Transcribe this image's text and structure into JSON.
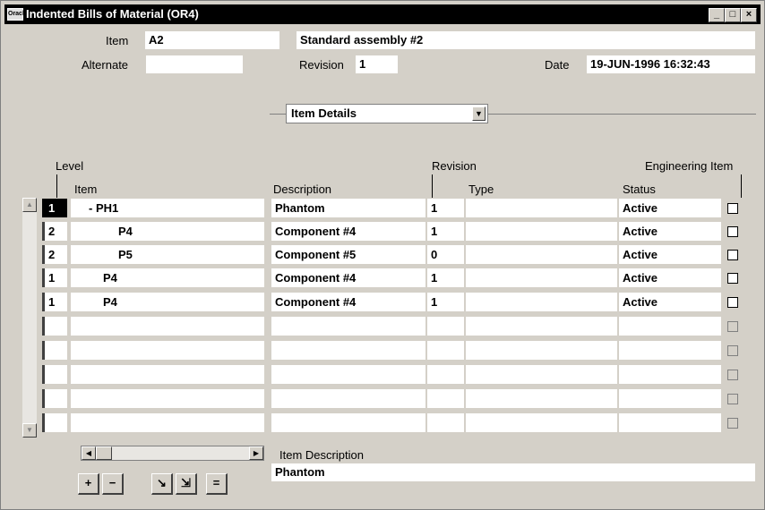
{
  "window": {
    "title": "Indented Bills of Material (OR4)",
    "app_icon_label": "Oracle",
    "minimize": "_",
    "maximize": "□",
    "close": "×"
  },
  "header": {
    "item_label": "Item",
    "item_value": "A2",
    "item_description": "Standard assembly #2",
    "alternate_label": "Alternate",
    "alternate_value": "",
    "revision_label": "Revision",
    "revision_value": "1",
    "date_label": "Date",
    "date_value": "19-JUN-1996 16:32:43"
  },
  "region_select": {
    "selected": "Item Details"
  },
  "columns": {
    "level": "Level",
    "item": "Item",
    "description": "Description",
    "revision": "Revision",
    "type": "Type",
    "engineering_item": "Engineering Item",
    "status": "Status"
  },
  "rows": [
    {
      "level": "1",
      "item": "- PH1",
      "description": "Phantom",
      "revision": "1",
      "type": "",
      "status": "Active"
    },
    {
      "level": "2",
      "item": "P4",
      "description": "Component #4",
      "revision": "1",
      "type": "",
      "status": "Active"
    },
    {
      "level": "2",
      "item": "P5",
      "description": "Component #5",
      "revision": "0",
      "type": "",
      "status": "Active"
    },
    {
      "level": "1",
      "item": "P4",
      "description": "Component #4",
      "revision": "1",
      "type": "",
      "status": "Active"
    },
    {
      "level": "1",
      "item": "P4",
      "description": "Component #4",
      "revision": "1",
      "type": "",
      "status": "Active"
    },
    {
      "level": "",
      "item": "",
      "description": "",
      "revision": "",
      "type": "",
      "status": ""
    },
    {
      "level": "",
      "item": "",
      "description": "",
      "revision": "",
      "type": "",
      "status": ""
    },
    {
      "level": "",
      "item": "",
      "description": "",
      "revision": "",
      "type": "",
      "status": ""
    },
    {
      "level": "",
      "item": "",
      "description": "",
      "revision": "",
      "type": "",
      "status": ""
    },
    {
      "level": "",
      "item": "",
      "description": "",
      "revision": "",
      "type": "",
      "status": ""
    }
  ],
  "footer": {
    "item_description_label": "Item Description",
    "item_description_value": "Phantom"
  },
  "toolbar": {
    "expand": "+",
    "collapse": "−",
    "expand_one": "↘",
    "expand_all": "⇲",
    "collapse_all": "="
  }
}
